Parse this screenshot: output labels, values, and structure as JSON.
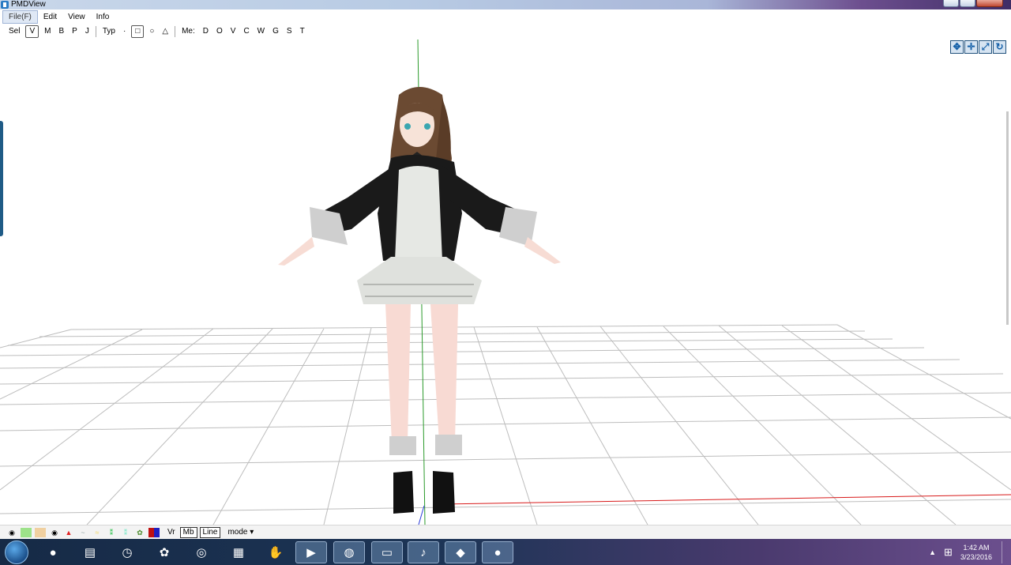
{
  "window": {
    "title": "PMDView"
  },
  "menu": {
    "items": [
      "File(F)",
      "Edit",
      "View",
      "Info"
    ]
  },
  "toolbar": {
    "sel_label": "Sel",
    "sel_items": [
      "V",
      "M",
      "B",
      "P",
      "J"
    ],
    "type_label": "Typ",
    "type_items": [
      "·",
      "□",
      "○",
      "△"
    ],
    "mesh_label": "Me:",
    "mesh_items": [
      "D",
      "O",
      "V",
      "C",
      "W",
      "G",
      "S",
      "T"
    ]
  },
  "view_controls": [
    "move-view-icon",
    "pan-view-icon",
    "zoom-view-icon",
    "rotate-view-icon"
  ],
  "statusbar": {
    "vr_label": "Vr",
    "mb_label": "Mb",
    "line_label": "Line",
    "mode_label": "mode",
    "mode_arrow": "▾"
  },
  "taskbar": {
    "apps": [
      "firefox",
      "file-manager",
      "clock-app",
      "flower-app",
      "eye-app",
      "snes-emulator",
      "paw-app",
      "media-player",
      "chrome",
      "folder",
      "miku-app",
      "pmdview",
      "firefox-2"
    ],
    "time": "1:42 AM",
    "date": "3/23/2016"
  },
  "colors": {
    "accent": "#1560a8",
    "title_left": "#c9d7ea",
    "title_right": "#3f2d66",
    "grid": "#bdbdbd",
    "y_axis": "#2a9a2a",
    "x_axis": "#d81a1a",
    "taskbar": "#162a46"
  }
}
